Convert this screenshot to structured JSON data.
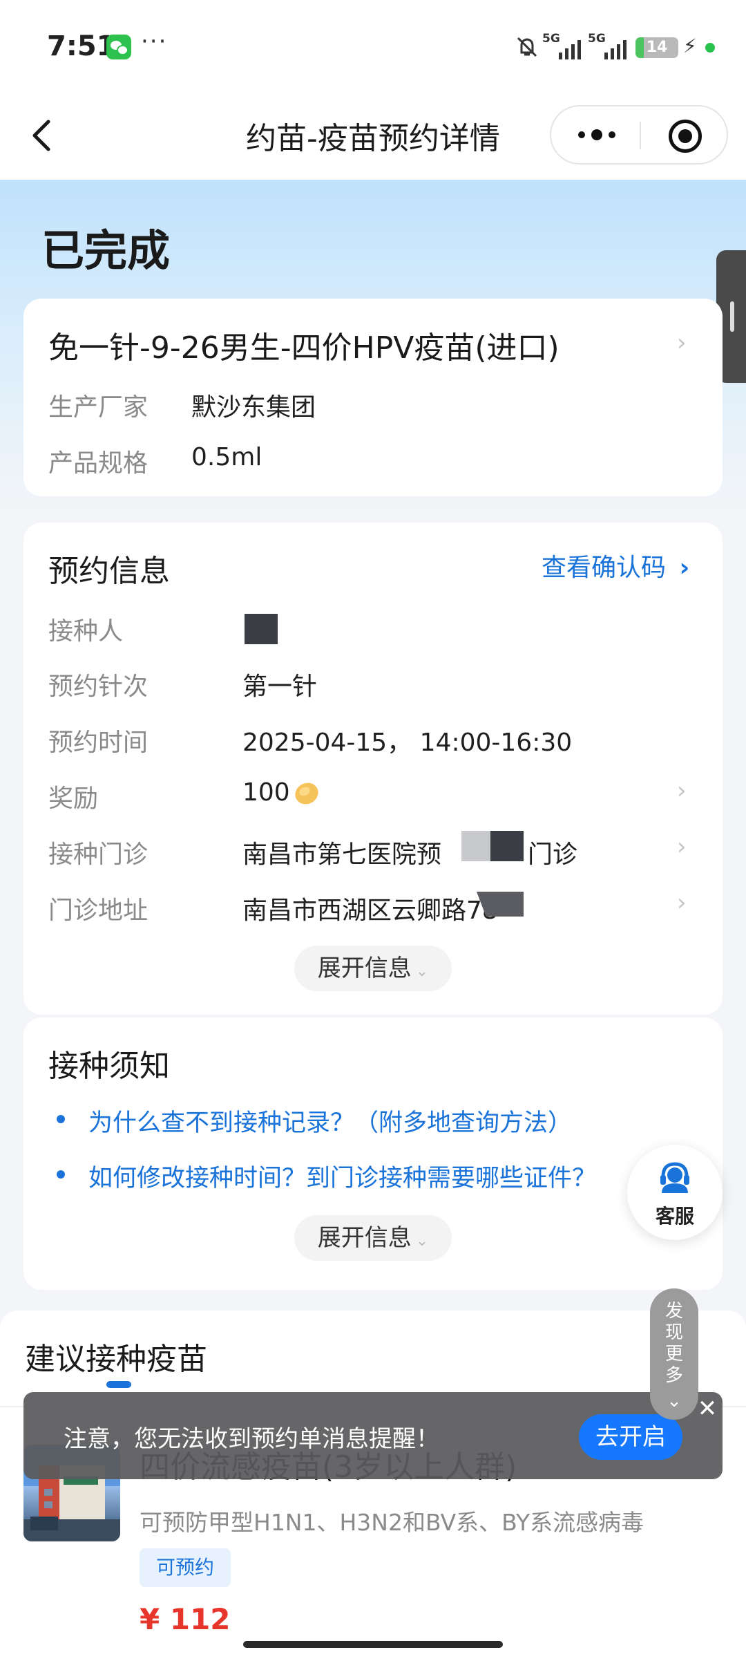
{
  "status_bar": {
    "time": "7:51",
    "dots": "···",
    "net1": "5G",
    "net2": "5G",
    "battery": "14"
  },
  "nav": {
    "title": "约苗-疫苗预约详情"
  },
  "order": {
    "status": "已完成"
  },
  "product": {
    "title": "免一针-9-26男生-四价HPV疫苗(进口)",
    "rows": [
      {
        "label": "生产厂家",
        "value": "默沙东集团"
      },
      {
        "label": "产品规格",
        "value": "0.5ml"
      }
    ]
  },
  "appointment": {
    "section_title": "预约信息",
    "confirm_link": "查看确认码",
    "rows": [
      {
        "label": "接种人",
        "value": ""
      },
      {
        "label": "预约针次",
        "value": "第一针"
      },
      {
        "label": "预约时间",
        "value": "2025-04-15， 14:00-16:30"
      },
      {
        "label": "奖励",
        "value": "100"
      },
      {
        "label": "接种门诊",
        "value": "南昌市第七医院预",
        "value_suffix": "门诊"
      },
      {
        "label": "门诊地址",
        "value": "南昌市西湖区云卿路78"
      }
    ],
    "expand_label": "展开信息"
  },
  "notice": {
    "section_title": "接种须知",
    "items": [
      "为什么查不到接种记录？（附多地查询方法）",
      "如何修改接种时间？到门诊接种需要哪些证件？"
    ],
    "expand_label": "展开信息"
  },
  "customer_service": {
    "label": "客服"
  },
  "discover": {
    "label": "发现更多"
  },
  "recommend": {
    "section_title": "建议接种疫苗",
    "vaccine": {
      "title": "四价流感疫苗(3岁以上人群)",
      "desc": "可预防甲型H1N1、H3N2和BV系、BY系流感病毒",
      "tag": "可预约",
      "price": "¥ 112"
    }
  },
  "toast": {
    "text": "注意，您无法收到预约单消息提醒！",
    "button": "去开启"
  },
  "colors": {
    "accent": "#1a73d9",
    "price": "#e8352b",
    "toast_button": "#1677ff"
  }
}
